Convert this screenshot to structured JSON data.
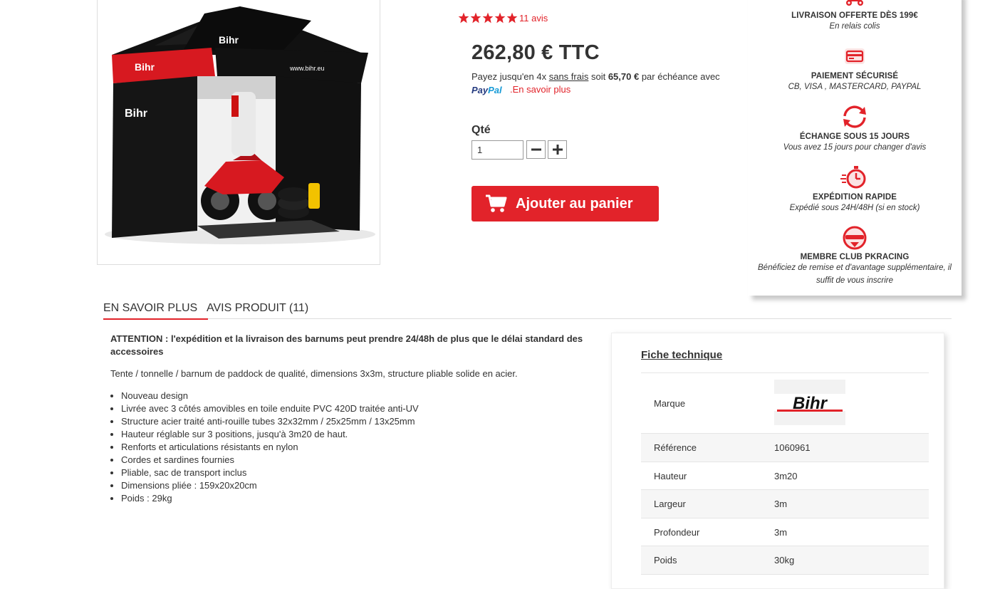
{
  "product": {
    "rating_stars": 5,
    "reviews_link": "11 avis",
    "price": "262,80 € TTC",
    "paypal": {
      "prefix": "Payez jusqu'en 4x ",
      "no_fees": "sans frais",
      "middle": " soit ",
      "installment": "65,70 €",
      "suffix": " par échéance avec",
      "logo_pay": "Pay",
      "logo_pal": "Pal",
      "learn_more": ".En savoir plus"
    },
    "qty_label": "Qté",
    "qty_value": "1",
    "add_to_cart": "Ajouter au panier"
  },
  "reassurance": [
    {
      "icon": "scooter-icon",
      "title": "LIVRAISON OFFERTE DÈS 199€",
      "subtitle": "En relais colis"
    },
    {
      "icon": "credit-card-icon",
      "title": "PAIEMENT SÉCURISÉ",
      "subtitle": "CB, VISA , MASTERCARD, PAYPAL"
    },
    {
      "icon": "exchange-arrows-icon",
      "title": "ÉCHANGE SOUS 15 JOURS",
      "subtitle": "Vous avez 15 jours pour changer d'avis"
    },
    {
      "icon": "stopwatch-icon",
      "title": "EXPÉDITION RAPIDE",
      "subtitle": "Expédié sous 24H/48H (si en stock)"
    },
    {
      "icon": "helmet-icon",
      "title": "MEMBRE CLUB PKRACING",
      "subtitle_line1": "Bénéficiez de remise et d'avantage supplémentaire, il",
      "subtitle_line2": "suffit de vous inscrire"
    }
  ],
  "tabs": [
    {
      "label": "EN SAVOIR PLUS",
      "active": true
    },
    {
      "label": "AVIS PRODUIT (11)",
      "active": false
    }
  ],
  "description": {
    "warning": "ATTENTION : l'expédition et la livraison des barnums peut prendre 24/48h de plus que le délai standard des accessoires",
    "intro": "Tente / tonnelle / barnum de paddock de qualité, dimensions 3x3m, structure pliable solide en acier.",
    "features": [
      "Nouveau design",
      "Livrée avec 3 côtés amovibles en toile enduite PVC 420D traitée anti-UV",
      "Structure acier traité anti-rouille tubes 32x32mm / 25x25mm / 13x25mm",
      "Hauteur réglable sur 3 positions, jusqu'à 3m20 de haut.",
      "Renforts et articulations résistants en nylon",
      "Cordes et sardines fournies",
      "Pliable, sac de transport inclus",
      "Dimensions pliée : 159x20x20cm",
      "Poids : 29kg"
    ]
  },
  "fiche": {
    "title": "Fiche technique",
    "brand_label": "Marque",
    "brand_logo_text": "Bihr",
    "rows": [
      {
        "label": "Référence",
        "value": "1060961"
      },
      {
        "label": "Hauteur",
        "value": "3m20"
      },
      {
        "label": "Largeur",
        "value": "3m"
      },
      {
        "label": "Profondeur",
        "value": "3m"
      },
      {
        "label": "Poids",
        "value": "30kg"
      }
    ]
  },
  "product_image": {
    "tent_lettering": "Bihr",
    "tent_url": "www.bihr.eu"
  },
  "colors": {
    "accent": "#e2232a",
    "text": "#333333",
    "paypal_dark": "#253b80",
    "paypal_light": "#179bd7"
  }
}
